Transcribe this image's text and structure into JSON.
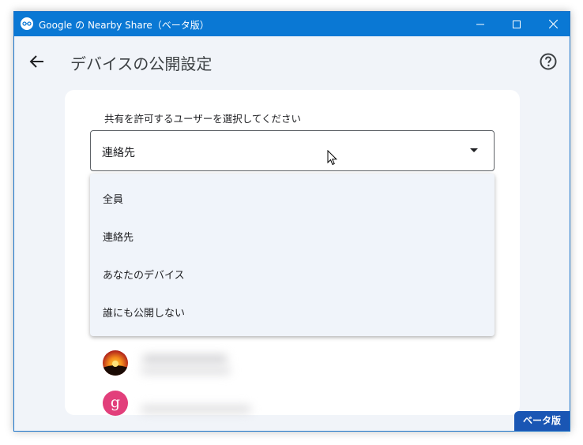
{
  "window": {
    "title": "Google の Nearby Share（ベータ版）"
  },
  "header": {
    "title": "デバイスの公開設定"
  },
  "visibility": {
    "label": "共有を許可するユーザーを選択してください",
    "selected": "連絡先",
    "options": [
      "全員",
      "連絡先",
      "あなたのデバイス",
      "誰にも公開しない"
    ]
  },
  "contacts": [
    {
      "avatar_letter": ""
    },
    {
      "avatar_letter": "g"
    }
  ],
  "badge": {
    "label": "ベータ版"
  },
  "colors": {
    "titlebar": "#0a78d4",
    "badge": "#1a56b4",
    "menu_background": "#f0f4fa",
    "avatar_pink": "#e23f7b"
  },
  "icons": [
    "nearby-share-icon",
    "minimize-icon",
    "maximize-icon",
    "close-icon",
    "back-arrow-icon",
    "help-icon",
    "dropdown-caret-icon",
    "mouse-cursor-icon"
  ]
}
